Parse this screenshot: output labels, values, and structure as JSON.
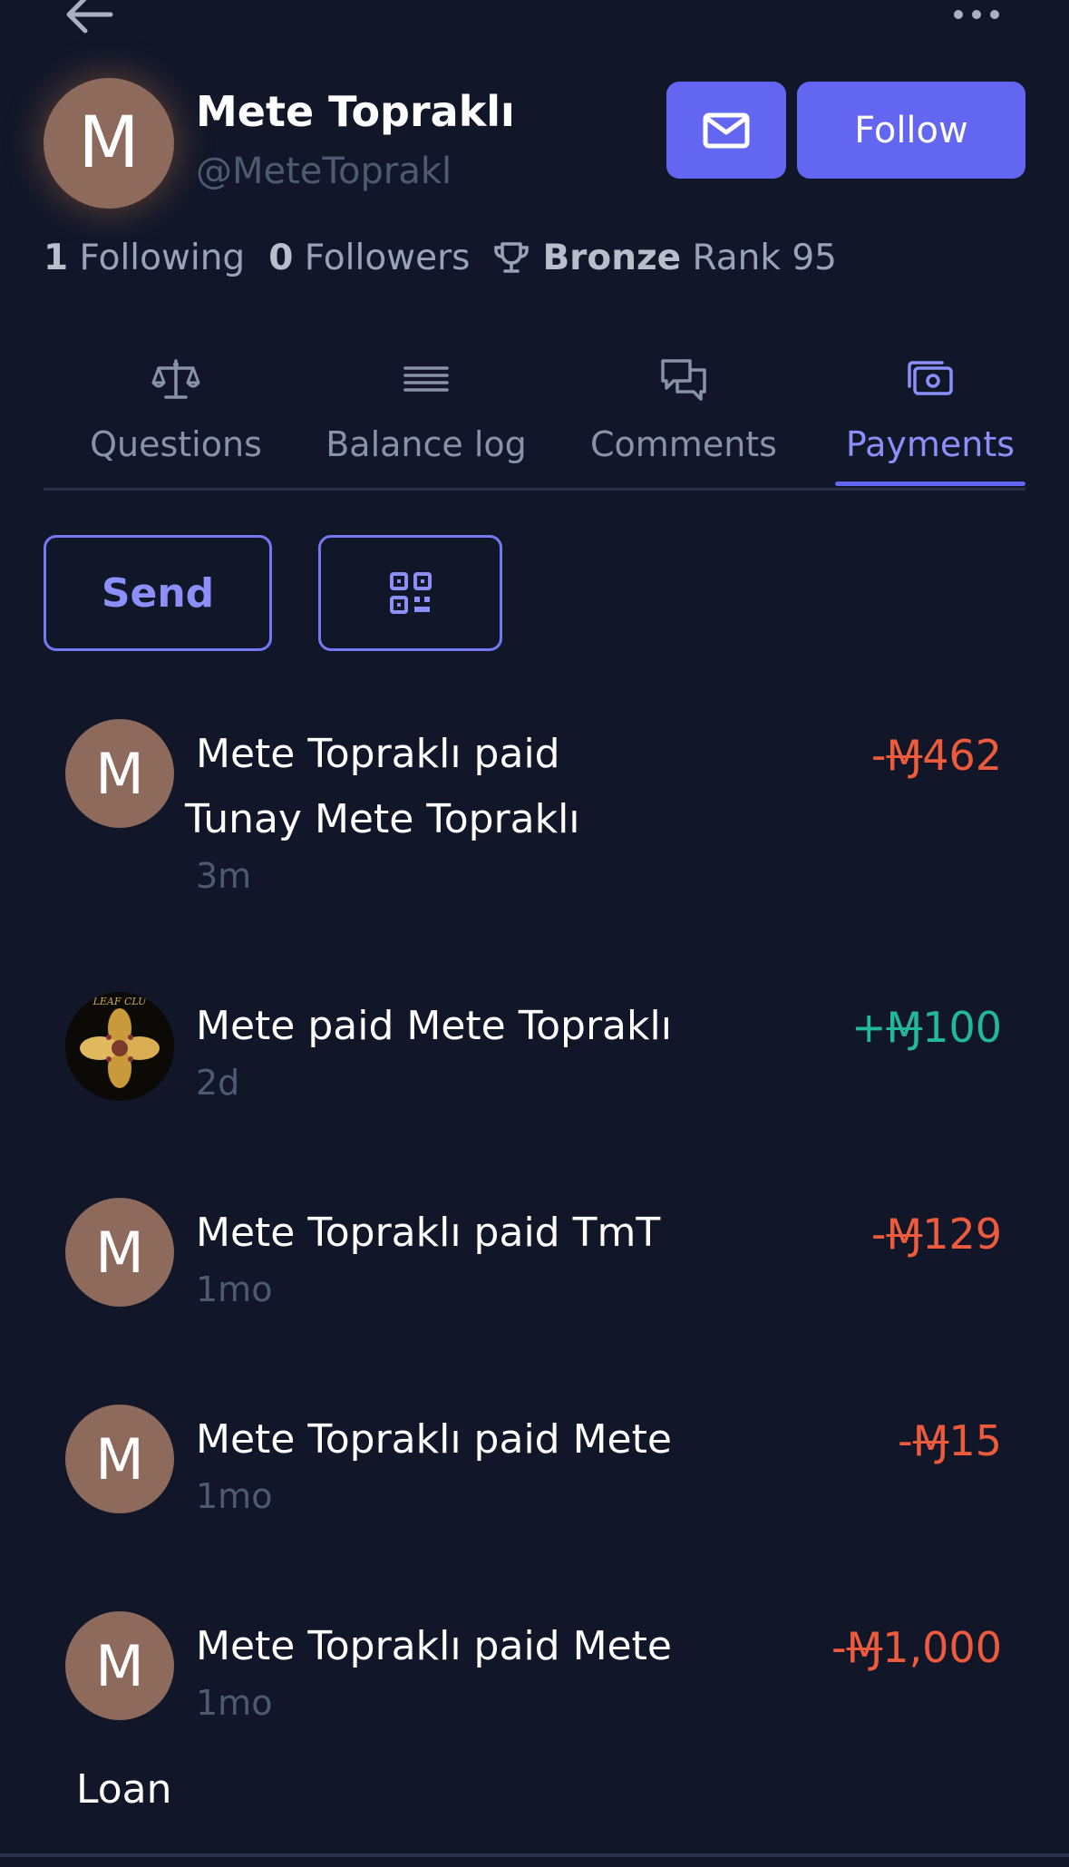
{
  "header": {
    "back_icon": "arrow-left-icon",
    "more_icon": "ellipsis-horizontal-icon"
  },
  "profile": {
    "avatar_initial": "M",
    "name": "Mete Topraklı",
    "handle": "@MeteToprakl",
    "message_icon": "envelope-icon",
    "follow_label": "Follow",
    "following_count": "1",
    "following_label": "Following",
    "followers_count": "0",
    "followers_label": "Followers",
    "trophy_icon": "trophy-icon",
    "league": "Bronze",
    "rank_label": "Rank 95"
  },
  "tabs": [
    {
      "label": "Questions",
      "icon": "scale-icon",
      "active": false
    },
    {
      "label": "Balance log",
      "icon": "list-icon",
      "active": false
    },
    {
      "label": "Comments",
      "icon": "chat-bubbles-icon",
      "active": false
    },
    {
      "label": "Payments",
      "icon": "cash-icon",
      "active": true
    }
  ],
  "actions": {
    "send_label": "Send",
    "qr_icon": "qr-code-icon"
  },
  "payments": [
    {
      "avatar": "M",
      "line1": "Mete Topraklı paid",
      "line2": "Tunay Mete Topraklı",
      "time": "3m",
      "sign": "-",
      "currency": "Ɱ",
      "amount": "462",
      "direction": "negative"
    },
    {
      "avatar": "leaf-club-logo",
      "line1": "Mete paid Mete Topraklı",
      "time": "2d",
      "sign": "+",
      "currency": "Ɱ",
      "amount": "100",
      "direction": "positive"
    },
    {
      "avatar": "M",
      "line1": "Mete Topraklı paid TmT",
      "time": "1mo",
      "sign": "-",
      "currency": "Ɱ",
      "amount": "129",
      "direction": "negative"
    },
    {
      "avatar": "M",
      "line1": "Mete Topraklı paid Mete",
      "time": "1mo",
      "sign": "-",
      "currency": "Ɱ",
      "amount": "15",
      "direction": "negative"
    },
    {
      "avatar": "M",
      "line1": "Mete Topraklı paid Mete",
      "time": "1mo",
      "sign": "-",
      "currency": "Ɱ",
      "amount": "1,000",
      "direction": "negative",
      "note": "Loan"
    }
  ],
  "colors": {
    "background": "#111729",
    "accent": "#6366f1",
    "negative": "#ee5a3c",
    "positive": "#22b89a"
  }
}
